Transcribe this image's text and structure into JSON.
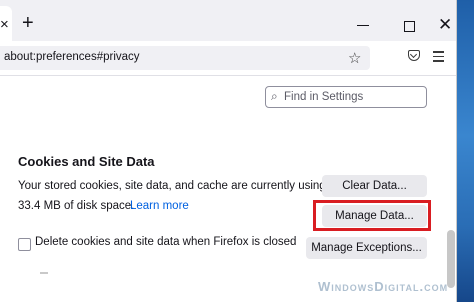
{
  "browser": {
    "new_tab_label": "+",
    "tab_close_label": "×",
    "url": "about:preferences#privacy",
    "window_controls": {
      "minimize_icon": "minimize-icon",
      "maximize_icon": "maximize-icon",
      "close_label": "✕"
    },
    "toolbar_icons": [
      "star-icon",
      "pocket-icon",
      "hamburger-menu-icon"
    ]
  },
  "search": {
    "placeholder": "Find in Settings",
    "value": "",
    "icon": "search-icon"
  },
  "cookies_section": {
    "title": "Cookies and Site Data",
    "description_line1": "Your stored cookies, site data, and cache are currently using",
    "description_line2": "33.4 MB of disk space.",
    "learn_more_label": "Learn more",
    "clear_data_label": "Clear Data...",
    "manage_data_label": "Manage Data...",
    "manage_exceptions_label": "Manage Exceptions...",
    "delete_on_close_label": "Delete cookies and site data when Firefox is closed",
    "delete_on_close_checked": false
  },
  "watermark": "WindowsDigital.com",
  "colors": {
    "highlight": "#d91d22",
    "link": "#0061e0",
    "button_bg": "#e9e9ed"
  }
}
